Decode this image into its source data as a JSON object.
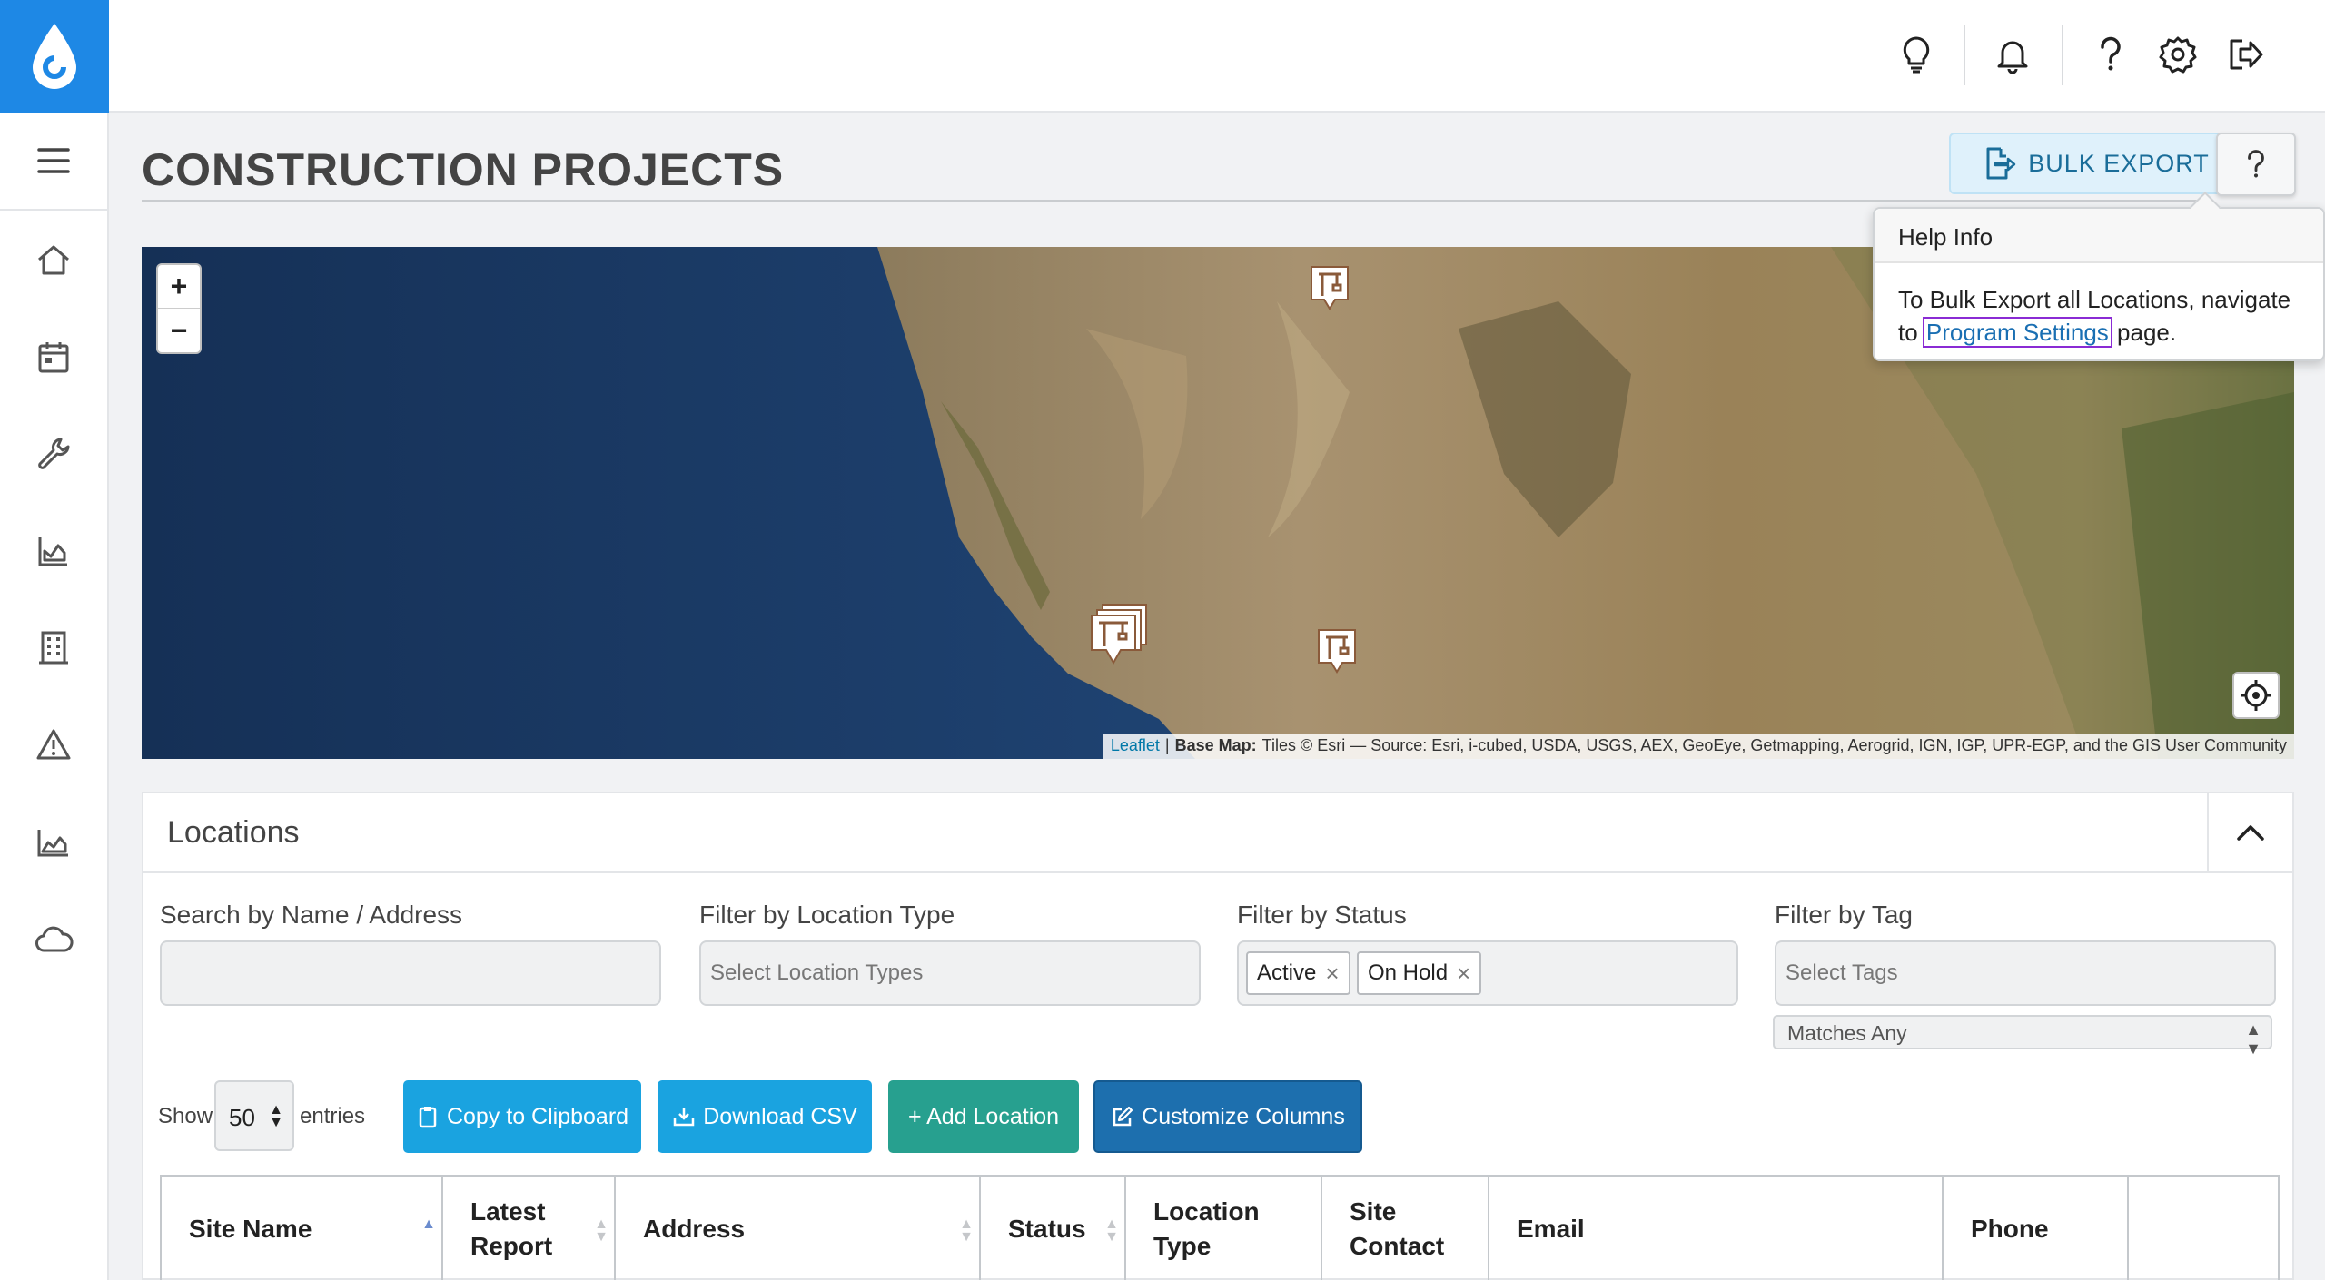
{
  "page": {
    "title": "CONSTRUCTION PROJECTS",
    "bulk_export_label": "BULK EXPORT"
  },
  "topbar": {
    "icons": [
      "lightbulb-icon",
      "bell-icon",
      "help-icon",
      "gear-icon",
      "logout-icon"
    ]
  },
  "sidebar": {
    "items": [
      "home-icon",
      "calendar-icon",
      "wrench-icon",
      "chart-icon",
      "building-icon",
      "warning-icon",
      "area-chart-icon",
      "cloud-icon"
    ]
  },
  "map": {
    "zoom_in": "+",
    "zoom_out": "−",
    "attribution": {
      "leaflet": "Leaflet",
      "separator": "|",
      "base_map_label": "Base Map:",
      "text": "Tiles © Esri — Source: Esri, i-cubed, USDA, USGS, AEX, GeoEye, Getmapping, Aerogrid, IGN, IGP, UPR-EGP, and the GIS User Community"
    }
  },
  "popover": {
    "title": "Help Info",
    "body_before": "To Bulk Export all Locations, navigate to ",
    "link": "Program Settings",
    "body_after": " page."
  },
  "locations": {
    "title": "Locations",
    "filters": {
      "search_label": "Search by Name / Address",
      "search_value": "",
      "type_label": "Filter by Location Type",
      "type_placeholder": "Select Location Types",
      "status_label": "Filter by Status",
      "status_chips": [
        "Active",
        "On Hold"
      ],
      "tag_label": "Filter by Tag",
      "tag_placeholder": "Select Tags",
      "tag_match": "Matches Any"
    },
    "show_label": "Show",
    "entries_value": "50",
    "entries_label": "entries",
    "buttons": {
      "copy": "Copy to Clipboard",
      "download": "Download CSV",
      "add": "+ Add Location",
      "customize": "Customize Columns"
    },
    "columns": [
      "Site Name",
      "Latest Report",
      "Address",
      "Status",
      "Location Type",
      "Site Contact",
      "Email",
      "Phone",
      ""
    ]
  },
  "colors": {
    "brand": "#1e88e5",
    "copy_btn": "#1aa3e0",
    "download_btn": "#1aa3e0",
    "add_btn": "#27a08f",
    "customize_btn": "#1d6fae"
  }
}
